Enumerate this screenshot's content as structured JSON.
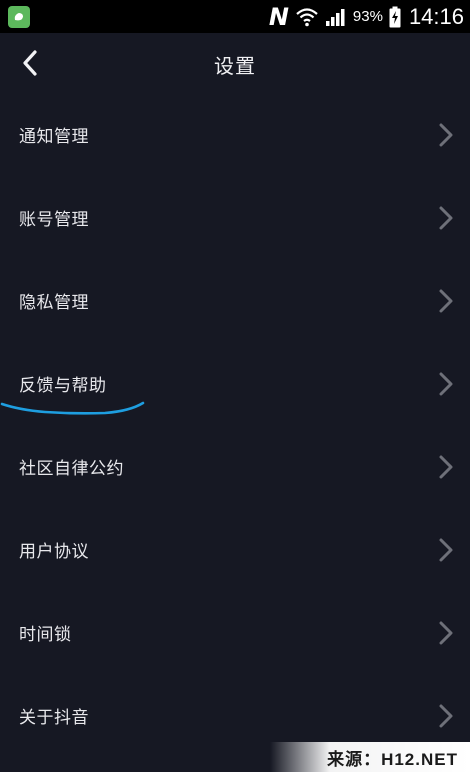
{
  "status_bar": {
    "battery_percent": "93%",
    "time": "14:16",
    "notification_letter": "N"
  },
  "header": {
    "title": "设置"
  },
  "menu": {
    "items": [
      {
        "label": "通知管理"
      },
      {
        "label": "账号管理"
      },
      {
        "label": "隐私管理"
      },
      {
        "label": "反馈与帮助"
      },
      {
        "label": "社区自律公约"
      },
      {
        "label": "用户协议"
      },
      {
        "label": "时间锁"
      },
      {
        "label": "关于抖音"
      }
    ]
  },
  "watermark": {
    "text": "来源：H12.NET"
  },
  "colors": {
    "background": "#161823",
    "text": "#e8e8ec",
    "chevron": "#6e7079",
    "annotation": "#1e9ee0"
  }
}
